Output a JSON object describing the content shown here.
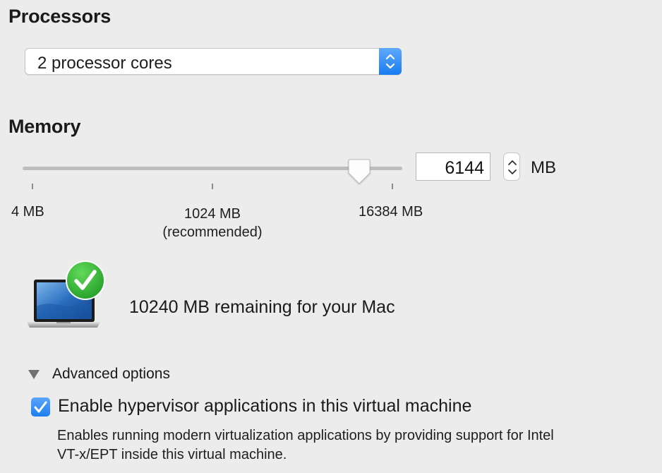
{
  "processors": {
    "heading": "Processors",
    "selected": "2 processor cores"
  },
  "memory": {
    "heading": "Memory",
    "value": "6144",
    "unit": "MB",
    "slider": {
      "min_label": "4 MB",
      "recommended_label": "1024 MB",
      "recommended_note": "(recommended)",
      "max_label": "16384 MB",
      "current_mb": 6144,
      "min_mb": 4,
      "max_mb": 16384
    },
    "remaining_text": "10240 MB remaining for your Mac"
  },
  "advanced": {
    "label": "Advanced options",
    "hypervisor_checkbox_label": "Enable hypervisor applications in this virtual machine",
    "hypervisor_checked": true,
    "description_line1": "Enables running modern virtualization applications by providing support for Intel",
    "description_line2": "VT-x/EPT inside this virtual machine."
  },
  "colors": {
    "accent": "#1c7ef0",
    "success": "#2fb234",
    "background": "#ececec"
  },
  "icons": {
    "popup": "up-down-chevron-icon",
    "laptop": "laptop-icon",
    "status": "checkmark-circle-icon",
    "disclosure": "disclosure-triangle-icon",
    "checkbox": "checkmark-icon"
  }
}
